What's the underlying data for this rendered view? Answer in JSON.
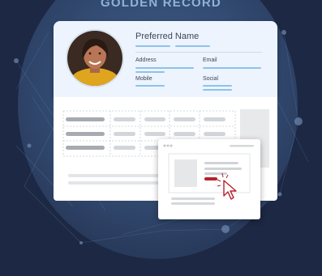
{
  "header": {
    "title": "GOLDEN RECORD"
  },
  "profile": {
    "preferred_name_label": "Preferred Name",
    "address_label": "Address",
    "email_label": "Email",
    "mobile_label": "Mobile",
    "social_label": "Social"
  },
  "colors": {
    "background": "#1c2844",
    "card_blue": "#edf4fd",
    "line_blue": "#8ec2ec",
    "accent_red": "#b4232e"
  },
  "icons": [
    "avatar-photo",
    "cursor-click-icon"
  ]
}
